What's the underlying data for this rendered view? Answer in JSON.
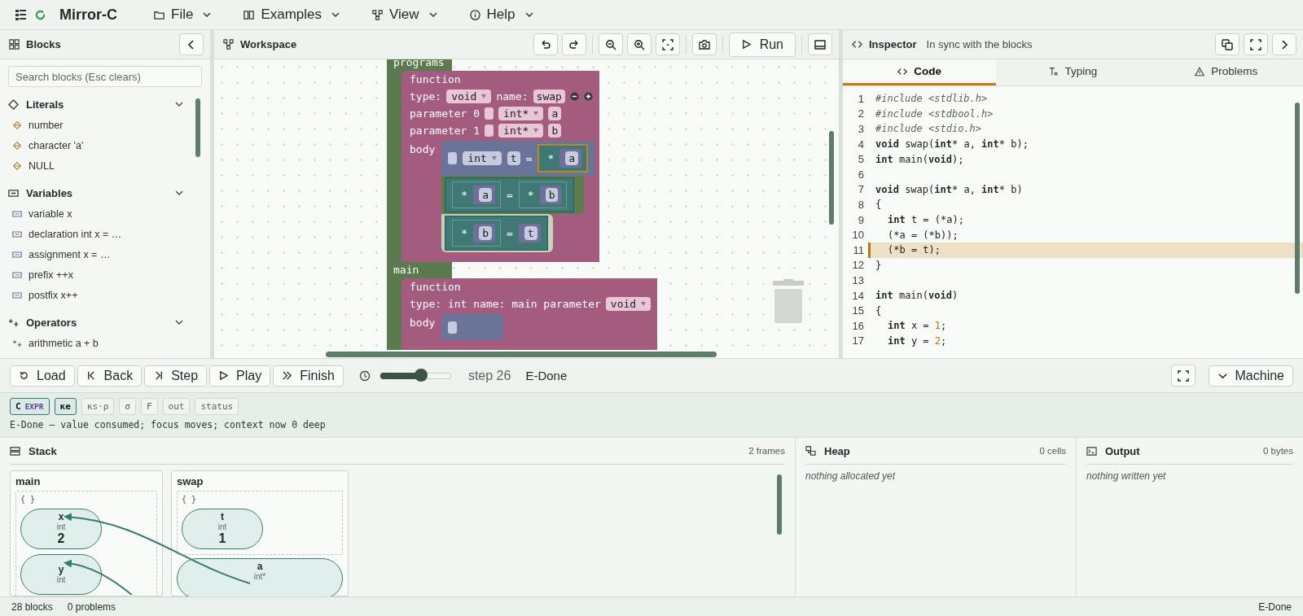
{
  "app": {
    "title": "Mirror-C",
    "menus": [
      {
        "label": "File",
        "kind": "file"
      },
      {
        "label": "Examples",
        "kind": "book"
      },
      {
        "label": "View",
        "kind": "view"
      },
      {
        "label": "Help",
        "kind": "help"
      }
    ]
  },
  "sidebar": {
    "title": "Blocks",
    "search": {
      "placeholder": "Search blocks (Esc clears)"
    },
    "categories": [
      {
        "name": "Literals",
        "kind": "literal",
        "expanded": true,
        "items": [
          "number",
          "character 'a'",
          "NULL"
        ]
      },
      {
        "name": "Variables",
        "kind": "variable",
        "expanded": true,
        "items": [
          "variable x",
          "declaration int x = …",
          "assignment x = …",
          "prefix ++x",
          "postfix x++"
        ]
      },
      {
        "name": "Operators",
        "kind": "operator",
        "expanded": true,
        "items": [
          "arithmetic a + b"
        ]
      }
    ]
  },
  "workspace": {
    "title": "Workspace",
    "run_label": "Run",
    "stacks": [
      {
        "label": "programs",
        "function": {
          "title": "function",
          "rows": [
            [
              {
                "kind": "text",
                "text": "type:"
              },
              {
                "kind": "dropdown",
                "text": "void"
              },
              {
                "kind": "text",
                "text": "name:"
              },
              {
                "kind": "field",
                "text": "swap"
              },
              {
                "kind": "minus"
              },
              {
                "kind": "plus"
              }
            ],
            [
              {
                "kind": "text",
                "text": "parameter 0"
              },
              {
                "kind": "check",
                "checked": false
              },
              {
                "kind": "dropdown",
                "text": "int*"
              },
              {
                "kind": "field",
                "text": "a"
              }
            ],
            [
              {
                "kind": "text",
                "text": "parameter 1"
              },
              {
                "kind": "check",
                "checked": false
              },
              {
                "kind": "dropdown",
                "text": "int*"
              },
              {
                "kind": "field",
                "text": "b"
              }
            ]
          ],
          "body_label": "body",
          "body": [
            {
              "kind": "decl",
              "executed": false,
              "current": false,
              "tokens": [
                {
                  "kind": "check",
                  "checked": false
                },
                {
                  "kind": "dropdown",
                  "text": "int"
                },
                {
                  "kind": "field",
                  "text": "t"
                },
                {
                  "kind": "text",
                  "text": "="
                },
                {
                  "kind": "deref",
                  "op": "*",
                  "var": "a",
                  "highlight": true
                }
              ]
            },
            {
              "kind": "assign",
              "executed": true,
              "current": false,
              "tokens": [
                {
                  "kind": "deref",
                  "op": "*",
                  "var": "a",
                  "highlight": false
                },
                {
                  "kind": "text",
                  "text": "="
                },
                {
                  "kind": "deref",
                  "op": "*",
                  "var": "b",
                  "highlight": false
                }
              ]
            },
            {
              "kind": "assign",
              "executed": false,
              "current": true,
              "tokens": [
                {
                  "kind": "deref",
                  "op": "*",
                  "var": "b",
                  "highlight": false
                },
                {
                  "kind": "text",
                  "text": "="
                },
                {
                  "kind": "var",
                  "var": "t"
                }
              ]
            }
          ]
        }
      },
      {
        "label": "main",
        "function": {
          "title": "function",
          "rows": [
            [
              {
                "kind": "text",
                "text": "type: int name: main parameter"
              },
              {
                "kind": "dropdown",
                "text": "void"
              }
            ]
          ],
          "body_label": "body",
          "body": [
            {
              "kind": "decl",
              "executed": false,
              "current": false,
              "tokens": [
                {
                  "kind": "check",
                  "checked": false
                }
              ]
            }
          ]
        }
      }
    ]
  },
  "inspector": {
    "title": "Inspector",
    "status": "In sync with the blocks",
    "tabs": [
      {
        "label": "Code",
        "kind": "code",
        "selected": true
      },
      {
        "label": "Typing",
        "kind": "typing",
        "selected": false
      },
      {
        "label": "Problems",
        "kind": "problems",
        "selected": false
      }
    ],
    "lines": [
      {
        "n": "1",
        "current": false,
        "indent": false,
        "segs": [
          {
            "kind": "pp",
            "t": "#include <stdlib.h>"
          }
        ]
      },
      {
        "n": "2",
        "current": false,
        "indent": false,
        "segs": [
          {
            "kind": "pp",
            "t": "#include <stdbool.h>"
          }
        ]
      },
      {
        "n": "3",
        "current": false,
        "indent": false,
        "segs": [
          {
            "kind": "pp",
            "t": "#include <stdio.h>"
          }
        ]
      },
      {
        "n": "4",
        "current": false,
        "indent": false,
        "segs": [
          {
            "kind": "kw",
            "t": "void"
          },
          {
            "kind": "tx",
            "t": " swap("
          },
          {
            "kind": "kw",
            "t": "int"
          },
          {
            "kind": "tx",
            "t": "* a, "
          },
          {
            "kind": "kw",
            "t": "int"
          },
          {
            "kind": "tx",
            "t": "* b);"
          }
        ]
      },
      {
        "n": "5",
        "current": false,
        "indent": false,
        "segs": [
          {
            "kind": "kw",
            "t": "int"
          },
          {
            "kind": "tx",
            "t": " main("
          },
          {
            "kind": "kw",
            "t": "void"
          },
          {
            "kind": "tx",
            "t": ");"
          }
        ]
      },
      {
        "n": "6",
        "current": false
      },
      {
        "n": "7",
        "current": false,
        "indent": false,
        "segs": [
          {
            "kind": "kw",
            "t": "void"
          },
          {
            "kind": "tx",
            "t": " swap("
          },
          {
            "kind": "kw",
            "t": "int"
          },
          {
            "kind": "tx",
            "t": "* a, "
          },
          {
            "kind": "kw",
            "t": "int"
          },
          {
            "kind": "tx",
            "t": "* b)"
          }
        ]
      },
      {
        "n": "8",
        "current": false,
        "indent": false,
        "segs": [
          {
            "kind": "tx",
            "t": "{"
          }
        ]
      },
      {
        "n": "9",
        "current": false,
        "indent": true,
        "segs": [
          {
            "kind": "kw",
            "t": "int"
          },
          {
            "kind": "tx",
            "t": " t = (*a);"
          }
        ]
      },
      {
        "n": "10",
        "current": false,
        "indent": true,
        "segs": [
          {
            "kind": "tx",
            "t": "(*a = (*b));"
          }
        ]
      },
      {
        "n": "11",
        "current": true,
        "indent": true,
        "segs": [
          {
            "kind": "tx",
            "t": "(*b = t);"
          }
        ]
      },
      {
        "n": "12",
        "current": false,
        "indent": false,
        "segs": [
          {
            "kind": "tx",
            "t": "}"
          }
        ]
      },
      {
        "n": "13",
        "current": false
      },
      {
        "n": "14",
        "current": false,
        "indent": false,
        "segs": [
          {
            "kind": "kw",
            "t": "int"
          },
          {
            "kind": "tx",
            "t": " main("
          },
          {
            "kind": "kw",
            "t": "void"
          },
          {
            "kind": "tx",
            "t": ")"
          }
        ]
      },
      {
        "n": "15",
        "current": false,
        "indent": false,
        "segs": [
          {
            "kind": "tx",
            "t": "{"
          }
        ]
      },
      {
        "n": "16",
        "current": false,
        "indent": true,
        "segs": [
          {
            "kind": "kw",
            "t": "int"
          },
          {
            "kind": "tx",
            "t": " x = "
          },
          {
            "kind": "num",
            "t": "1"
          },
          {
            "kind": "tx",
            "t": ";"
          }
        ]
      },
      {
        "n": "17",
        "current": false,
        "indent": true,
        "segs": [
          {
            "kind": "kw",
            "t": "int"
          },
          {
            "kind": "tx",
            "t": " y = "
          },
          {
            "kind": "num",
            "t": "2"
          },
          {
            "kind": "tx",
            "t": ";"
          }
        ]
      }
    ]
  },
  "controls": {
    "buttons": [
      {
        "label": "Load",
        "kind": "load"
      },
      {
        "label": "Back",
        "kind": "back"
      },
      {
        "label": "Step",
        "kind": "step"
      },
      {
        "label": "Play",
        "kind": "play"
      },
      {
        "label": "Finish",
        "kind": "finish"
      }
    ],
    "speed": {
      "level": 0.58
    },
    "step": "step 26",
    "state": "E-Done",
    "panel_button": "Machine"
  },
  "chips": [
    {
      "label": "C",
      "sub": "EXPR",
      "selected": true
    },
    {
      "label": "κe",
      "selected": true
    },
    {
      "label": "κs·ρ",
      "selected": false
    },
    {
      "label": "σ",
      "selected": false
    },
    {
      "label": "F",
      "selected": false
    },
    {
      "label": "out",
      "selected": false
    },
    {
      "label": "status",
      "selected": false
    }
  ],
  "message": "E-Done — value consumed; focus moves; context now 0 deep",
  "stack": {
    "title": "Stack",
    "count": "2 frames",
    "frames": [
      {
        "name": "main",
        "scopes": [
          {
            "label": "{ }",
            "vars": [
              {
                "name": "x",
                "type": "int",
                "value": "2"
              },
              {
                "name": "y",
                "type": "int"
              }
            ]
          }
        ]
      },
      {
        "name": "swap",
        "scopes": [
          {
            "label": "{ }",
            "vars": [
              {
                "name": "t",
                "type": "int",
                "value": "1"
              }
            ]
          }
        ],
        "vars": [
          {
            "name": "a",
            "type": "int*"
          }
        ]
      }
    ]
  },
  "heap": {
    "title": "Heap",
    "count": "0 cells",
    "empty": "nothing allocated yet"
  },
  "output": {
    "title": "Output",
    "count": "0 bytes",
    "empty": "nothing written yet"
  },
  "status_bar": {
    "blocks": "28 blocks",
    "problems": "0 problems",
    "state": "E-Done"
  }
}
